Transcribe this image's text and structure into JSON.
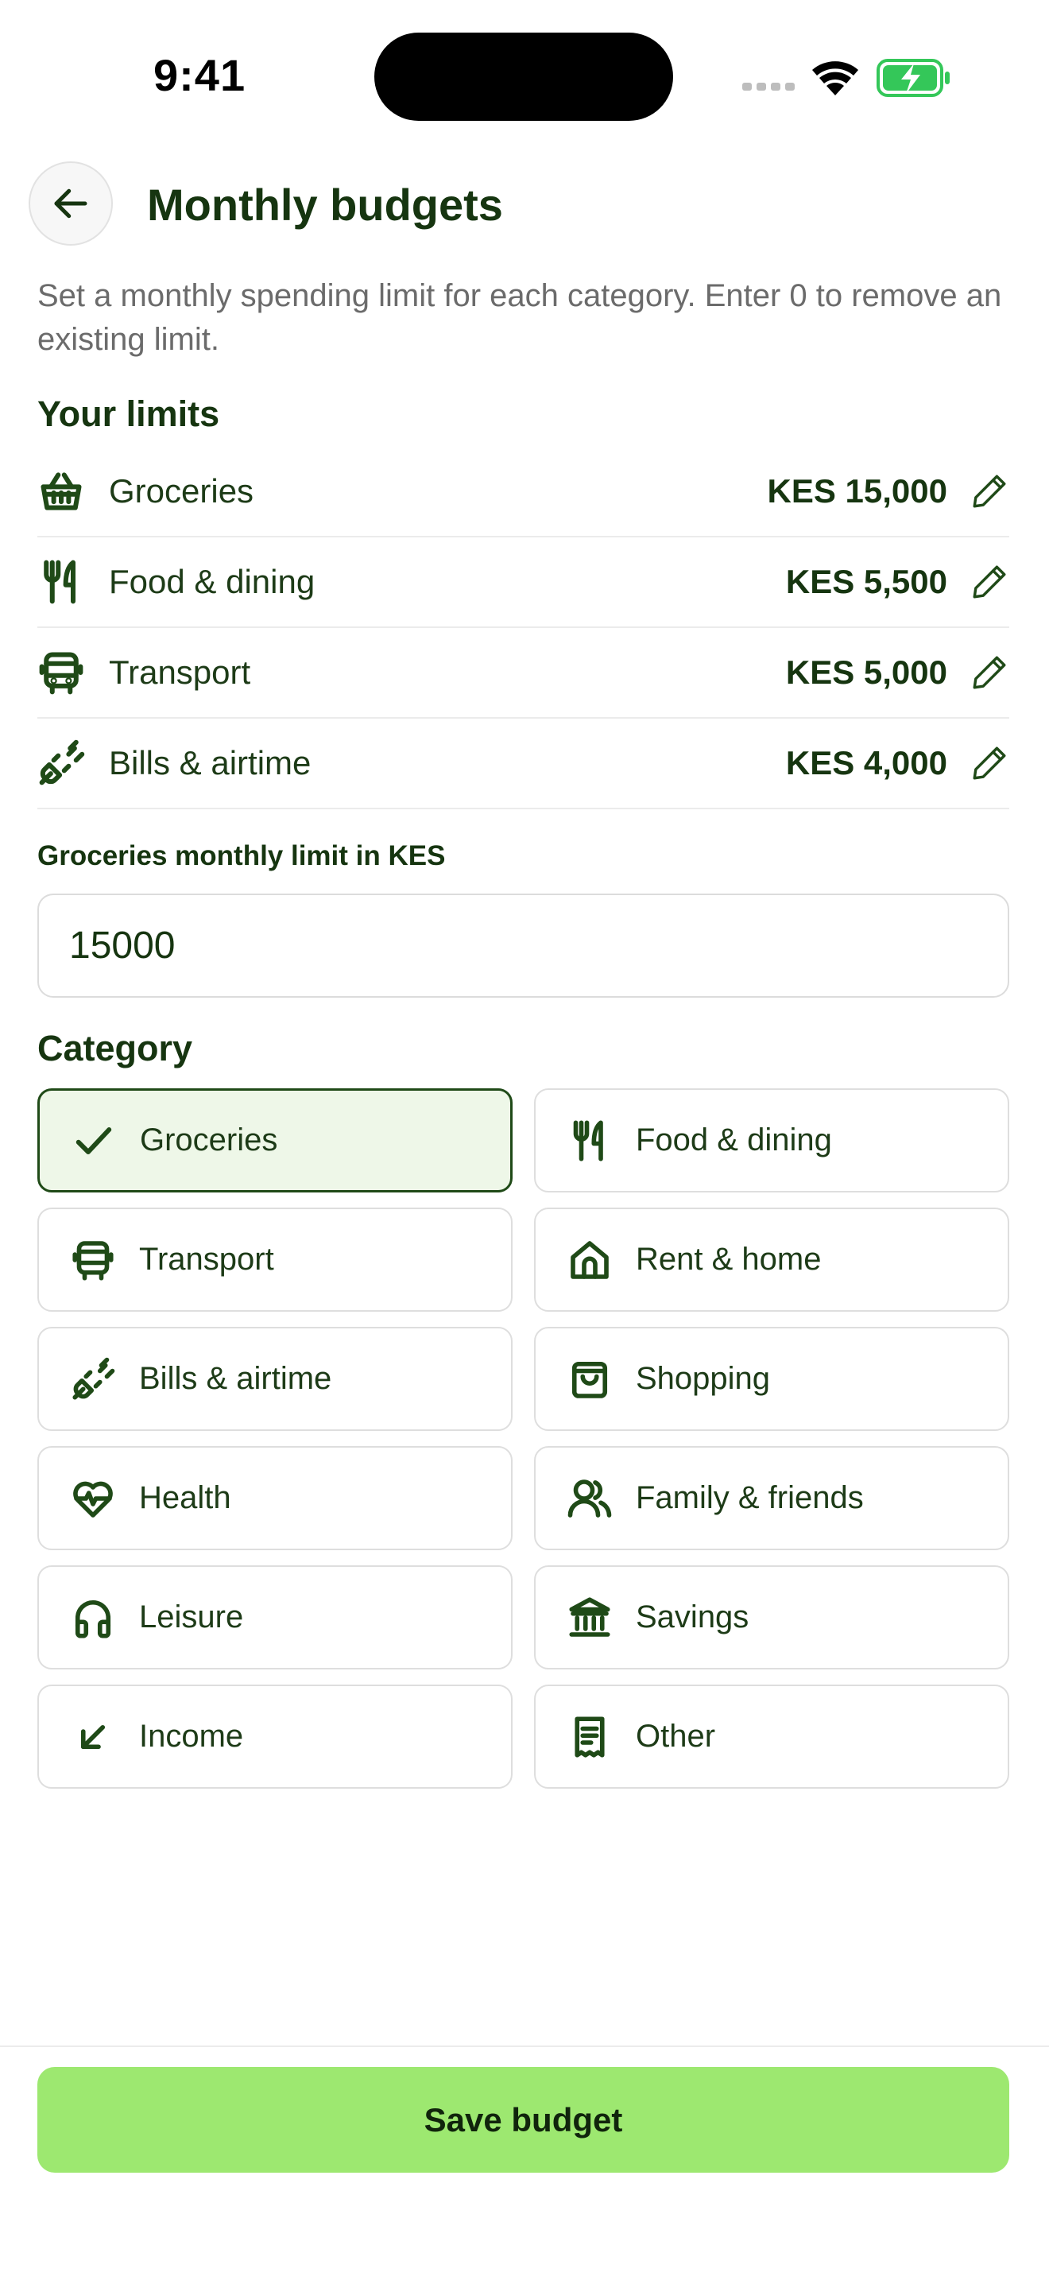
{
  "status_bar": {
    "time": "9:41"
  },
  "header": {
    "title": "Monthly budgets"
  },
  "subtitle": "Set a monthly spending limit for each category. Enter 0 to remove an existing limit.",
  "limits_section": {
    "heading": "Your limits",
    "items": [
      {
        "icon": "basket-icon",
        "label": "Groceries",
        "amount": "KES 15,000"
      },
      {
        "icon": "fork-knife-icon",
        "label": "Food & dining",
        "amount": "KES 5,500"
      },
      {
        "icon": "bus-icon",
        "label": "Transport",
        "amount": "KES 5,000"
      },
      {
        "icon": "plug-icon",
        "label": "Bills & airtime",
        "amount": "KES 4,000"
      }
    ]
  },
  "limit_input": {
    "label": "Groceries monthly limit in KES",
    "value": "15000"
  },
  "category_section": {
    "heading": "Category",
    "selected": "Groceries",
    "items": [
      {
        "icon": "check-icon",
        "label": "Groceries"
      },
      {
        "icon": "fork-knife-icon",
        "label": "Food & dining"
      },
      {
        "icon": "bus-icon",
        "label": "Transport"
      },
      {
        "icon": "house-icon",
        "label": "Rent & home"
      },
      {
        "icon": "plug-icon",
        "label": "Bills & airtime"
      },
      {
        "icon": "shopping-bag-icon",
        "label": "Shopping"
      },
      {
        "icon": "heart-pulse-icon",
        "label": "Health"
      },
      {
        "icon": "users-icon",
        "label": "Family & friends"
      },
      {
        "icon": "headphones-icon",
        "label": "Leisure"
      },
      {
        "icon": "bank-icon",
        "label": "Savings"
      },
      {
        "icon": "arrow-down-left-icon",
        "label": "Income"
      },
      {
        "icon": "receipt-icon",
        "label": "Other"
      }
    ]
  },
  "footer": {
    "save_label": "Save budget"
  },
  "colors": {
    "accent": "#9de870",
    "text_dark": "#163510",
    "selected_bg": "#eef7e8"
  }
}
